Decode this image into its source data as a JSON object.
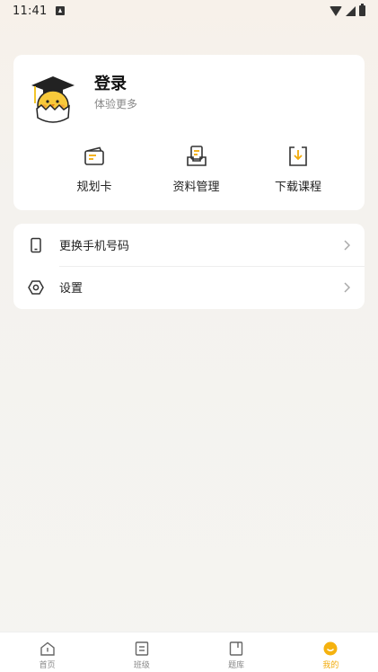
{
  "status_bar": {
    "time": "11:41"
  },
  "profile": {
    "title": "登录",
    "subtitle": "体验更多",
    "avatar_icon": "graduate-chick-avatar"
  },
  "quick_actions": [
    {
      "label": "规划卡",
      "icon": "plan-card-icon"
    },
    {
      "label": "资料管理",
      "icon": "materials-icon"
    },
    {
      "label": "下载课程",
      "icon": "download-course-icon"
    }
  ],
  "settings_list": [
    {
      "label": "更换手机号码",
      "icon": "phone-icon"
    },
    {
      "label": "设置",
      "icon": "settings-hexagon-icon"
    }
  ],
  "bottom_nav": [
    {
      "label": "首页",
      "icon": "home-icon",
      "active": false
    },
    {
      "label": "班级",
      "icon": "class-icon",
      "active": false
    },
    {
      "label": "题库",
      "icon": "question-bank-icon",
      "active": false
    },
    {
      "label": "我的",
      "icon": "me-icon",
      "active": true
    }
  ],
  "colors": {
    "accent": "#f2ab0a",
    "text": "#222222",
    "muted": "#888888",
    "card": "#ffffff"
  }
}
